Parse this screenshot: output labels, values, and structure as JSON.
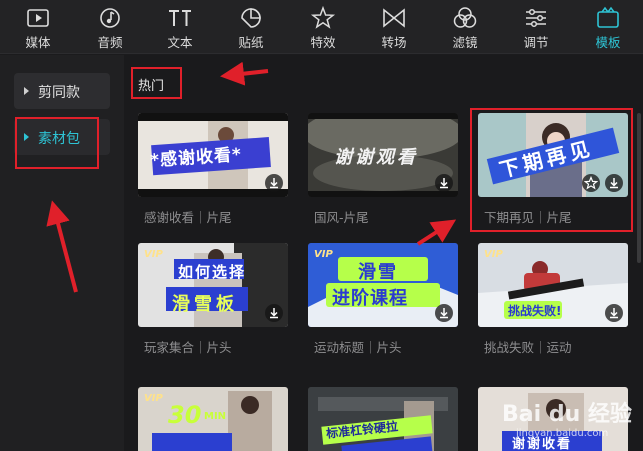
{
  "toolbar": {
    "items": [
      {
        "label": "媒体",
        "icon": "media-icon"
      },
      {
        "label": "音频",
        "icon": "audio-icon"
      },
      {
        "label": "文本",
        "icon": "text-icon"
      },
      {
        "label": "贴纸",
        "icon": "sticker-icon"
      },
      {
        "label": "特效",
        "icon": "effects-icon"
      },
      {
        "label": "转场",
        "icon": "transition-icon"
      },
      {
        "label": "滤镜",
        "icon": "filter-icon"
      },
      {
        "label": "调节",
        "icon": "adjust-icon"
      },
      {
        "label": "模板",
        "icon": "template-icon"
      }
    ],
    "active": "模板",
    "active_color": "#2ec3d4"
  },
  "sidebar": {
    "items": [
      {
        "label": "剪同款"
      },
      {
        "label": "素材包"
      }
    ],
    "active": "素材包"
  },
  "main": {
    "section_title": "热门",
    "cards": [
      {
        "caption": "感谢收看｜片尾",
        "thumb_text": "*感谢收看*"
      },
      {
        "caption": "国风-片尾",
        "thumb_text": "谢谢观看"
      },
      {
        "caption": "下期再见｜片尾",
        "thumb_text": "下期再见"
      },
      {
        "caption": "玩家集合｜片头",
        "thumb_text_1": "如何选择",
        "thumb_text_2": "滑雪板",
        "badge": "VIP"
      },
      {
        "caption": "运动标题｜片头",
        "thumb_text_1": "滑雪",
        "thumb_text_2": "进阶课程",
        "badge": "VIP"
      },
      {
        "caption": "挑战失败｜运动",
        "thumb_text": "挑战失败!",
        "badge": "VIP"
      },
      {
        "caption": "",
        "thumb_text_1": "30",
        "thumb_text_2": "MIN",
        "badge": "VIP"
      },
      {
        "caption": "",
        "thumb_text": "标准杠铃硬拉"
      },
      {
        "caption": "",
        "thumb_text": "谢谢收看"
      }
    ]
  },
  "watermark": {
    "text": "Bai du 经验",
    "sub": "jingyan.baidu.com"
  },
  "colors": {
    "accent": "#2ec3d4",
    "annotation_red": "#e0202a"
  }
}
